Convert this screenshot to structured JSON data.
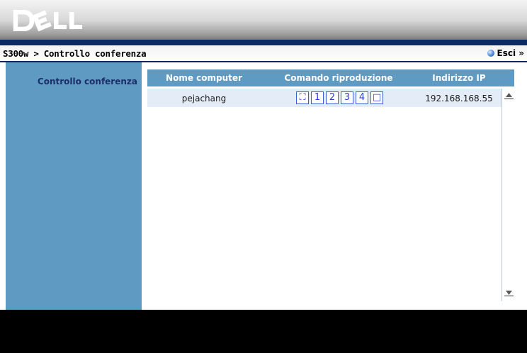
{
  "header": {
    "logo_text": "DELL"
  },
  "titlebar": {
    "breadcrumb": "S300w > Controllo conferenza",
    "logout_label": "Esci »"
  },
  "sidebar": {
    "active_item": "Controllo conferenza"
  },
  "table": {
    "columns": [
      "Nome computer",
      "Comando riproduzione",
      "Indirizzo IP"
    ],
    "rows": [
      {
        "computer": "pejachang",
        "controls": [
          "⛶",
          "1",
          "2",
          "3",
          "4",
          "□"
        ],
        "ip": "192.168.168.55"
      }
    ]
  },
  "colors": {
    "accent_blue": "#5f9ac3",
    "header_navy": "#0b2a63",
    "row_bg": "#e4ecf7"
  }
}
